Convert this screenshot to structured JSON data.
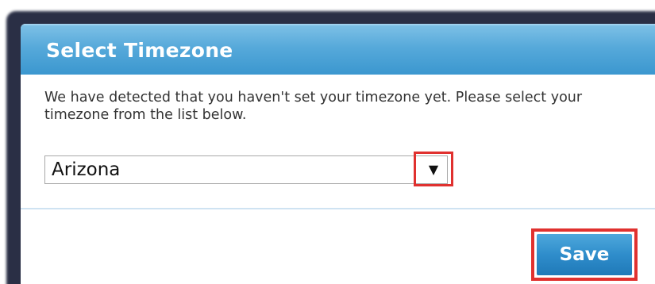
{
  "dialog": {
    "title": "Select Timezone",
    "message": "We have detected that you haven't set your timezone yet. Please select your timezone from the list below."
  },
  "timezone_select": {
    "selected_value": "Arizona",
    "arrow_icon": "chevron-down-icon",
    "arrow_glyph": "▼"
  },
  "actions": {
    "save_label": "Save"
  },
  "colors": {
    "header_accent": "#3b97cf",
    "button_accent": "#2f8dcb",
    "highlight_box": "#e0312f"
  }
}
